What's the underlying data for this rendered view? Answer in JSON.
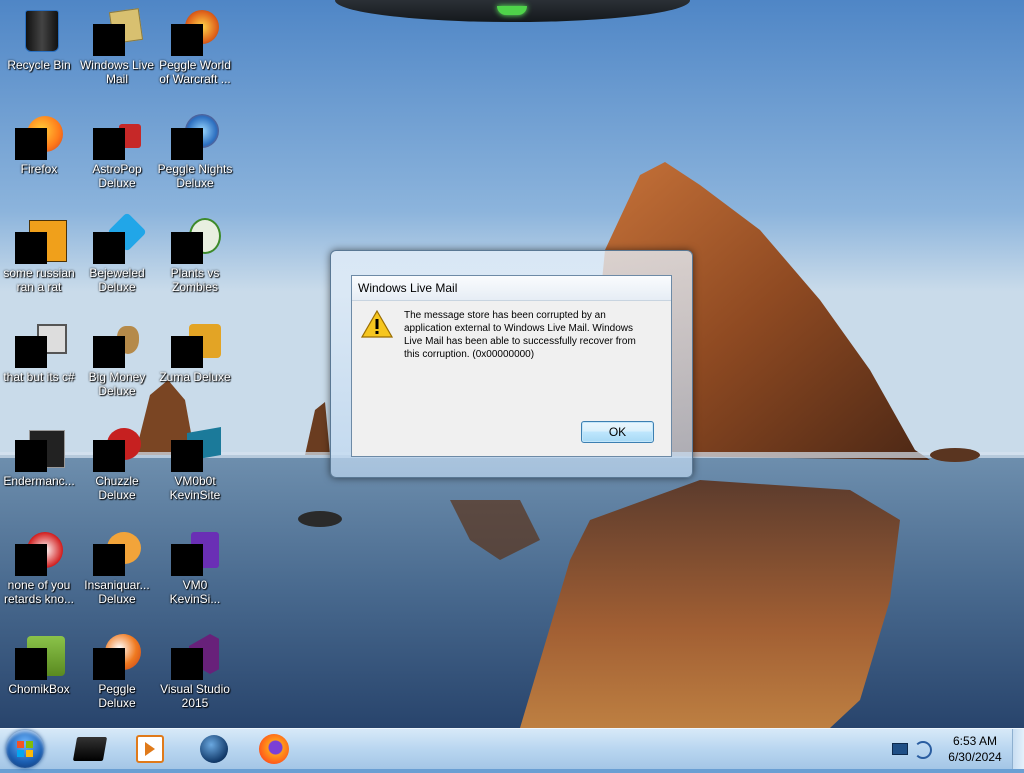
{
  "desktop": {
    "icons": [
      {
        "label": "Recycle Bin"
      },
      {
        "label": "Windows Live\nMail"
      },
      {
        "label": "Peggle World\nof Warcraft ..."
      },
      {
        "label": "Firefox"
      },
      {
        "label": "AstroPop\nDeluxe"
      },
      {
        "label": "Peggle Nights\nDeluxe"
      },
      {
        "label": "some russian\nran a rat"
      },
      {
        "label": "Bejeweled\nDeluxe"
      },
      {
        "label": "Plants vs\nZombies"
      },
      {
        "label": "that but its c#"
      },
      {
        "label": "Big Money\nDeluxe"
      },
      {
        "label": "Zuma Deluxe"
      },
      {
        "label": "Endermanc..."
      },
      {
        "label": "Chuzzle\nDeluxe"
      },
      {
        "label": "VM0b0t\nKevinSite"
      },
      {
        "label": "none of you\nretards kno..."
      },
      {
        "label": "Insaniquar...\nDeluxe"
      },
      {
        "label": "VM0\nKevinSi..."
      },
      {
        "label": "ChomikBox"
      },
      {
        "label": "Peggle Deluxe"
      },
      {
        "label": "Visual Studio\n2015"
      }
    ]
  },
  "dialog": {
    "title": "Windows Live Mail",
    "icon": "warning-icon",
    "message": "The message store has been corrupted by an application external to Windows Live Mail. Windows Live Mail has been able to successfully recover from this corruption. (0x00000000)",
    "ok_label": "OK"
  },
  "taskbar": {
    "pinned": [
      {
        "name": "taskbar-app-explorer",
        "icon": "black-box-icon"
      },
      {
        "name": "taskbar-app-media",
        "icon": "media-player-icon"
      },
      {
        "name": "taskbar-app-globe",
        "icon": "globe-icon"
      },
      {
        "name": "taskbar-app-firefox",
        "icon": "firefox-icon"
      }
    ],
    "clock": {
      "time": "6:53 AM",
      "date": "6/30/2024"
    }
  },
  "colors": {
    "sky": "#6a9fd3",
    "accent": "#3c7fb1"
  }
}
